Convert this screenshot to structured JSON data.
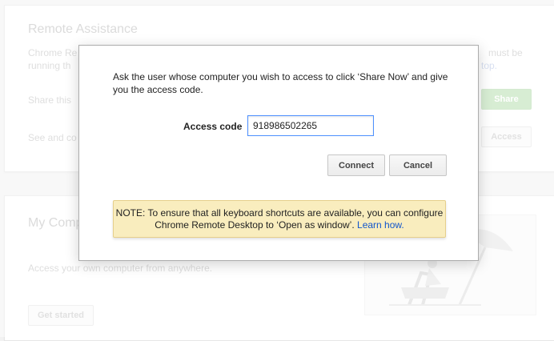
{
  "remote_assistance": {
    "title": "Remote Assistance",
    "text1_start": "Chrome Re",
    "text1_end": "must be",
    "text2_start": "running th",
    "text2_link": "top.",
    "share_text": "Share this",
    "share_button": "Share",
    "see_text": "See and co",
    "access_button": "Access"
  },
  "my_computers": {
    "title": "My Comp",
    "description": "Access your own computer from anywhere.",
    "get_started_button": "Get started"
  },
  "dialog": {
    "message": "Ask the user whose computer you wish to access to click ‘Share Now’ and give you the access code.",
    "access_code_label": "Access code",
    "access_code_value": "918986502265",
    "connect_button": "Connect",
    "cancel_button": "Cancel",
    "note_text": "NOTE: To ensure that all keyboard shortcuts are available, you can configure Chrome Remote Desktop to ‘Open as window’.",
    "note_link": "Learn how."
  },
  "colors": {
    "accent": "#4d90fe",
    "note_background": "#f9edbe",
    "link": "#1155cc",
    "share_green": "#b7dfb0"
  }
}
